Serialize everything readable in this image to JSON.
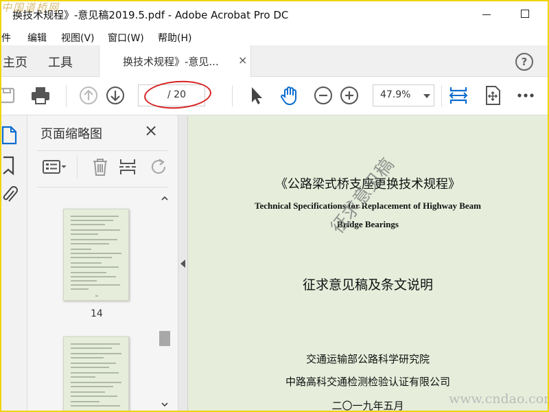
{
  "window": {
    "title": "换技术规程》-意见稿2019.5.pdf - Adobe Acrobat Pro DC",
    "logo_watermark": "中国道桥网"
  },
  "menu": [
    "文件",
    "编辑(E)",
    "视图(V)",
    "窗口(W)",
    "帮助(H)"
  ],
  "menu_visible": [
    "件",
    "编辑",
    "视图(V)",
    "窗口(W)",
    "帮助(H)"
  ],
  "tabs": {
    "home": "主页",
    "tools": "工具",
    "document": "换技术规程》-意见...",
    "close": "×",
    "help": "?"
  },
  "toolbar": {
    "page_total": "/ 20",
    "zoom": "47.9%",
    "icons": [
      "save-icon",
      "print-icon",
      "prev-page-icon",
      "next-page-icon",
      "select-arrow-icon",
      "hand-icon",
      "zoom-out-icon",
      "zoom-in-icon",
      "fit-width-icon",
      "fit-page-icon",
      "more-icon"
    ],
    "accent_color": "#0a6ccf"
  },
  "sidebar": {
    "title": "页面缩略图",
    "close": "×",
    "thumbnails": [
      {
        "label": "14"
      },
      {
        "label": ""
      }
    ]
  },
  "document": {
    "cn_title": "《公路梁式桥支座更换技术规程》",
    "en_title_line1": "Technical Specifications for Replacement of Highway Beam",
    "en_title_line2": "Bridge Bearings",
    "subtitle": "征求意见稿及条文说明",
    "stamp": "征求意见稿",
    "org1": "交通运输部公路科学研究院",
    "org2": "中路高科交通检测检验认证有限公司",
    "date": "二〇一九年五月",
    "background_color": "#e6eedb"
  },
  "site_watermark": "www.cndao.com",
  "annotation": {
    "circle_color": "#d81f1f"
  }
}
